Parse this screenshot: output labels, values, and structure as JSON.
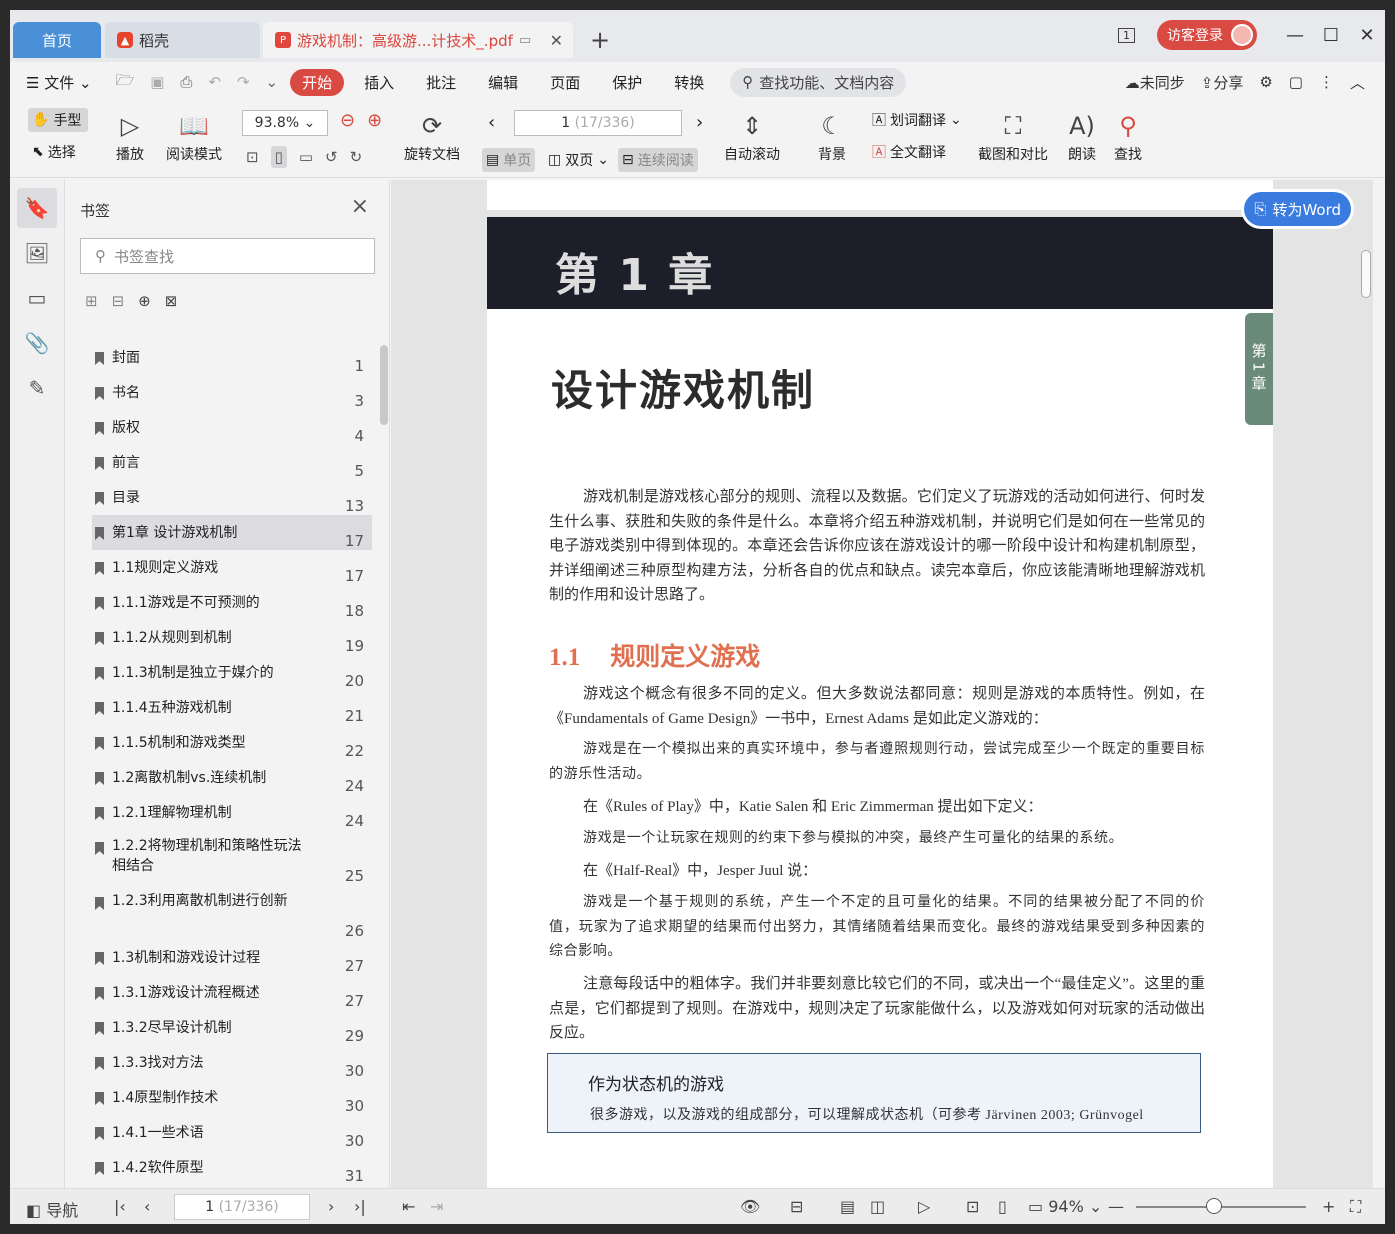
{
  "tabs": {
    "home": "首页",
    "daoke": "稻壳",
    "doc": "游戏机制：高级游...计技术_.pdf",
    "visitor_login": "访客登录"
  },
  "menu": {
    "file": "文件",
    "start": "开始",
    "insert": "插入",
    "annotate": "批注",
    "edit": "编辑",
    "page": "页面",
    "protect": "保护",
    "convert": "转换",
    "search_placeholder": "查找功能、文档内容",
    "unsynced": "未同步",
    "share": "分享"
  },
  "ribbon": {
    "hand": "手型",
    "select": "选择",
    "play": "播放",
    "read_mode": "阅读模式",
    "zoom": "93.8%",
    "rotate": "旋转文档",
    "page_current": "1",
    "page_total": "(17/336)",
    "single": "单页",
    "double": "双页",
    "continuous": "连续阅读",
    "auto_scroll": "自动滚动",
    "background": "背景",
    "word_translate": "划词翻译",
    "full_translate": "全文翻译",
    "screenshot_compare": "截图和对比",
    "read_aloud": "朗读",
    "find": "查找"
  },
  "bookmarks": {
    "title": "书签",
    "search_placeholder": "书签查找",
    "items": [
      {
        "label": "封面",
        "page": "1"
      },
      {
        "label": "书名",
        "page": "3"
      },
      {
        "label": "版权",
        "page": "4"
      },
      {
        "label": "前言",
        "page": "5"
      },
      {
        "label": "目录",
        "page": "13"
      },
      {
        "label": "第1章  设计游戏机制",
        "page": "17"
      },
      {
        "label": "1.1规则定义游戏",
        "page": "17"
      },
      {
        "label": "1.1.1游戏是不可预测的",
        "page": "18"
      },
      {
        "label": "1.1.2从规则到机制",
        "page": "19"
      },
      {
        "label": "1.1.3机制是独立于媒介的",
        "page": "20"
      },
      {
        "label": "1.1.4五种游戏机制",
        "page": "21"
      },
      {
        "label": "1.1.5机制和游戏类型",
        "page": "22"
      },
      {
        "label": "1.2离散机制vs.连续机制",
        "page": "24"
      },
      {
        "label": "1.2.1理解物理机制",
        "page": "24"
      },
      {
        "label": "1.2.2将物理机制和策略性玩法相结合",
        "page": "25"
      },
      {
        "label": "1.2.3利用离散机制进行创新",
        "page": "26"
      },
      {
        "label": "1.3机制和游戏设计过程",
        "page": "27"
      },
      {
        "label": "1.3.1游戏设计流程概述",
        "page": "27"
      },
      {
        "label": "1.3.2尽早设计机制",
        "page": "29"
      },
      {
        "label": "1.3.3找对方法",
        "page": "30"
      },
      {
        "label": "1.4原型制作技术",
        "page": "30"
      },
      {
        "label": "1.4.1一些术语",
        "page": "30"
      },
      {
        "label": "1.4.2软件原型",
        "page": "31"
      }
    ]
  },
  "document": {
    "to_word": "转为Word",
    "chapter_band": "第 1 章",
    "side_tab": "第1章",
    "title": "设计游戏机制",
    "intro": "游戏机制是游戏核心部分的规则、流程以及数据。它们定义了玩游戏的活动如何进行、何时发生什么事、获胜和失败的条件是什么。本章将介绍五种游戏机制，并说明它们是如何在一些常见的电子游戏类别中得到体现的。本章还会告诉你应该在游戏设计的哪一阶段中设计和构建机制原型，并详细阐述三种原型构建方法，分析各自的优点和缺点。读完本章后，你应该能清晰地理解游戏机制的作用和设计思路了。",
    "section_number": "1.1",
    "section_title": "规则定义游戏",
    "p1": "游戏这个概念有很多不同的定义。但大多数说法都同意：规则是游戏的本质特性。例如，在《Fundamentals of Game Design》一书中，Ernest Adams 是如此定义游戏的：",
    "q1": "游戏是在一个模拟出来的真实环境中，参与者遵照规则行动，尝试完成至少一个既定的重要目标的游乐性活动。",
    "p2": "在《Rules of Play》中，Katie Salen 和 Eric Zimmerman 提出如下定义：",
    "q2": "游戏是一个让玩家在规则的约束下参与模拟的冲突，最终产生可量化的结果的系统。",
    "p3": "在《Half-Real》中，Jesper Juul 说：",
    "q3": "游戏是一个基于规则的系统，产生一个不定的且可量化的结果。不同的结果被分配了不同的价值，玩家为了追求期望的结果而付出努力，其情绪随着结果而变化。最终的游戏结果受到多种因素的综合影响。",
    "p4": "注意每段话中的粗体字。我们并非要刻意比较它们的不同，或决出一个“最佳定义”。这里的重点是，它们都提到了规则。在游戏中，规则决定了玩家能做什么，以及游戏如何对玩家的活动做出反应。",
    "box_title": "作为状态机的游戏",
    "box_text": "很多游戏，以及游戏的组成部分，可以理解成状态机（可参考 Järvinen 2003; Grünvogel"
  },
  "status": {
    "nav": "导航",
    "page_current": "1",
    "page_total": "(17/336)",
    "zoom": "94%"
  }
}
